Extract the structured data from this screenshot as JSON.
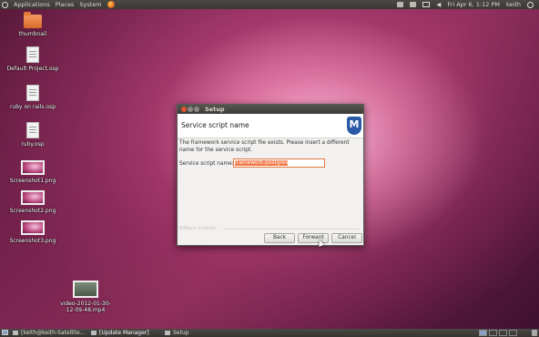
{
  "top_panel": {
    "menus": [
      "Applications",
      "Places",
      "System"
    ],
    "clock": "Fri Apr 6,  1:12 PM",
    "user": "keith"
  },
  "desktop_icons": [
    {
      "label": "thumbnail",
      "icon": "folder-icon"
    },
    {
      "label": "Default Project.osp",
      "icon": "document-icon"
    },
    {
      "label": "ruby on rails.osp",
      "icon": "document-icon"
    },
    {
      "label": "ruby.osp",
      "icon": "document-icon"
    },
    {
      "label": "Screenshot1.png",
      "icon": "image-icon"
    },
    {
      "label": "Screenshot2.png",
      "icon": "image-icon"
    },
    {
      "label": "Screenshot3.png",
      "icon": "image-icon"
    },
    {
      "label": "video-2012-01-30-12-09-48.mp4",
      "icon": "video-icon"
    }
  ],
  "dialog": {
    "window_title": "Setup",
    "header_title": "Service script name",
    "logo_letter": "M",
    "message": "The framework service script file exists. Please insert a different name for the service script.",
    "field_label": "Service script name:",
    "field_value": "framework-postgres",
    "footer_label": "BitRock Installer",
    "buttons": {
      "back": "Back",
      "forward": "Forward",
      "cancel": "Cancel"
    }
  },
  "taskbar": {
    "items": [
      "[keith@keith-Satellite...",
      "[Update Manager]",
      "Setup"
    ]
  }
}
